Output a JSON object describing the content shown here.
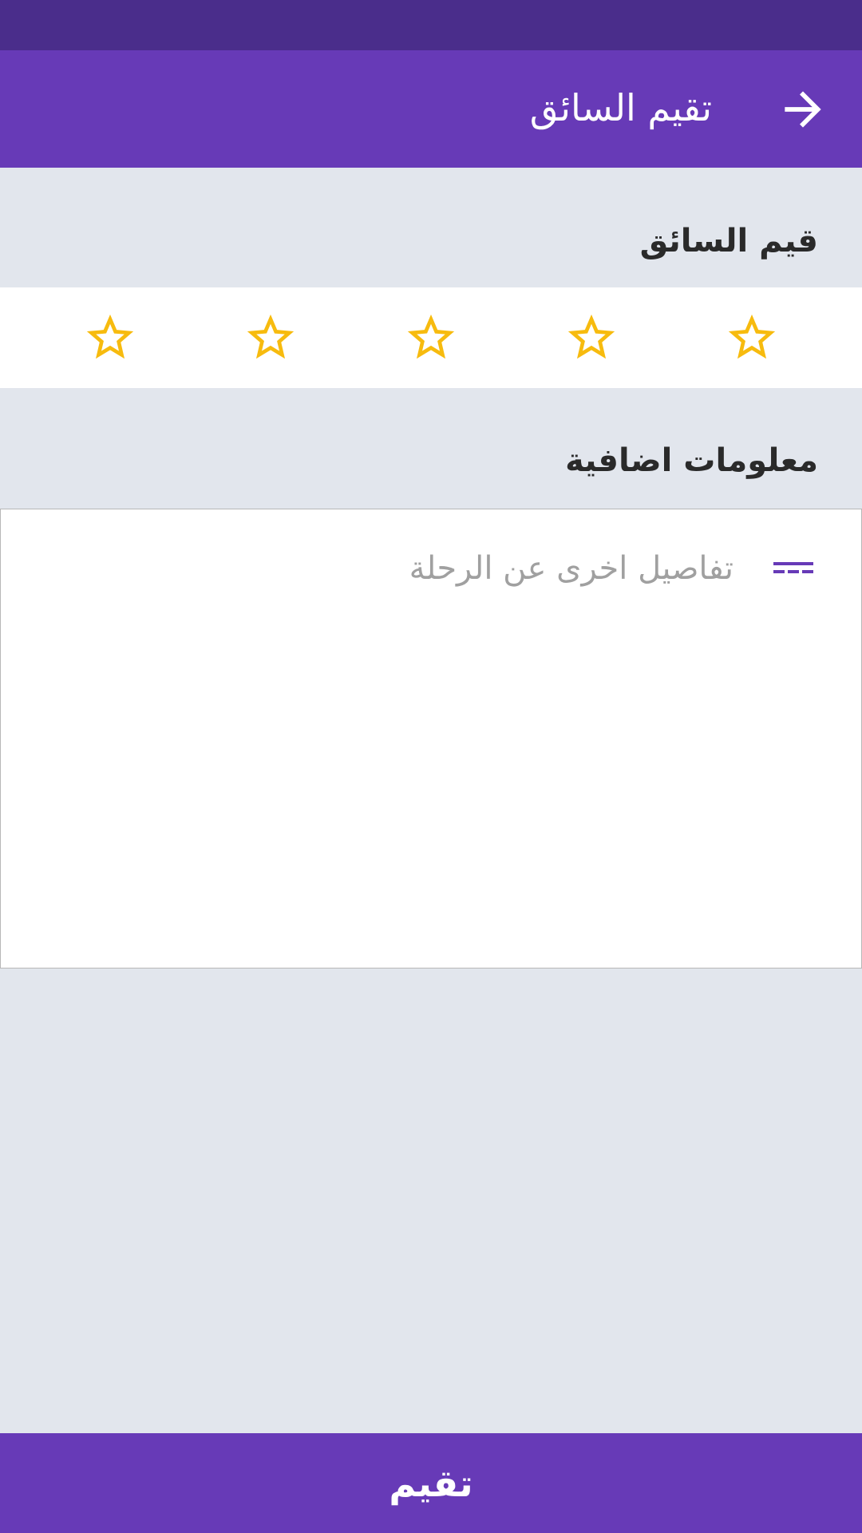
{
  "app_bar": {
    "title": "تقيم السائق",
    "back_icon": "arrow-forward-icon"
  },
  "rating_section": {
    "heading": "قيم السائق",
    "max_stars": 5,
    "rating": 0,
    "star_icon": "star-outline-icon",
    "star_color": "#f7bb0e"
  },
  "info_section": {
    "heading": "معلومات اضافية",
    "details_placeholder": "تفاصيل اخرى عن الرحلة",
    "details_value": "",
    "details_icon": "notes-icon"
  },
  "submit": {
    "label": "تقيم"
  },
  "colors": {
    "primary": "#673ab7",
    "status_bar": "#4a2d8b",
    "background": "#e2e6ed"
  }
}
